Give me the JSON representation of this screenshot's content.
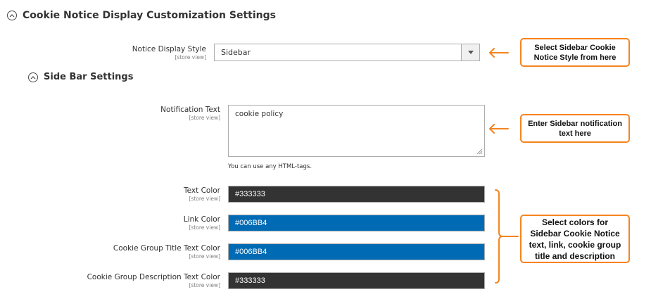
{
  "section": {
    "title": "Cookie Notice Display Customization Settings",
    "toggle_icon": "chevron-up-circle-icon"
  },
  "notice_display_style": {
    "label": "Notice Display Style",
    "scope": "[store view]",
    "value": "Sidebar"
  },
  "sidebar_settings": {
    "title": "Side Bar Settings",
    "toggle_icon": "chevron-up-circle-icon"
  },
  "notification_text": {
    "label": "Notification Text",
    "scope": "[store view]",
    "value": "cookie policy",
    "note": "You can use any HTML-tags."
  },
  "colors": [
    {
      "label": "Text Color",
      "scope": "[store view]",
      "value": "#333333",
      "bg": "#333333"
    },
    {
      "label": "Link Color",
      "scope": "[store view]",
      "value": "#006BB4",
      "bg": "#006BB4"
    },
    {
      "label": "Cookie Group Title Text Color",
      "scope": "[store view]",
      "value": "#006BB4",
      "bg": "#006BB4"
    },
    {
      "label": "Cookie Group Description Text Color",
      "scope": "[store view]",
      "value": "#333333",
      "bg": "#333333"
    }
  ],
  "callouts": {
    "style": [
      "Select Sidebar Cookie",
      "Notice Style from here"
    ],
    "notification": [
      "Enter Sidebar notification",
      "text here"
    ],
    "colors": [
      "Select colors for",
      "Sidebar Cookie Notice",
      "text, link, cookie group",
      "title and description"
    ],
    "accent": "#f5841f"
  }
}
